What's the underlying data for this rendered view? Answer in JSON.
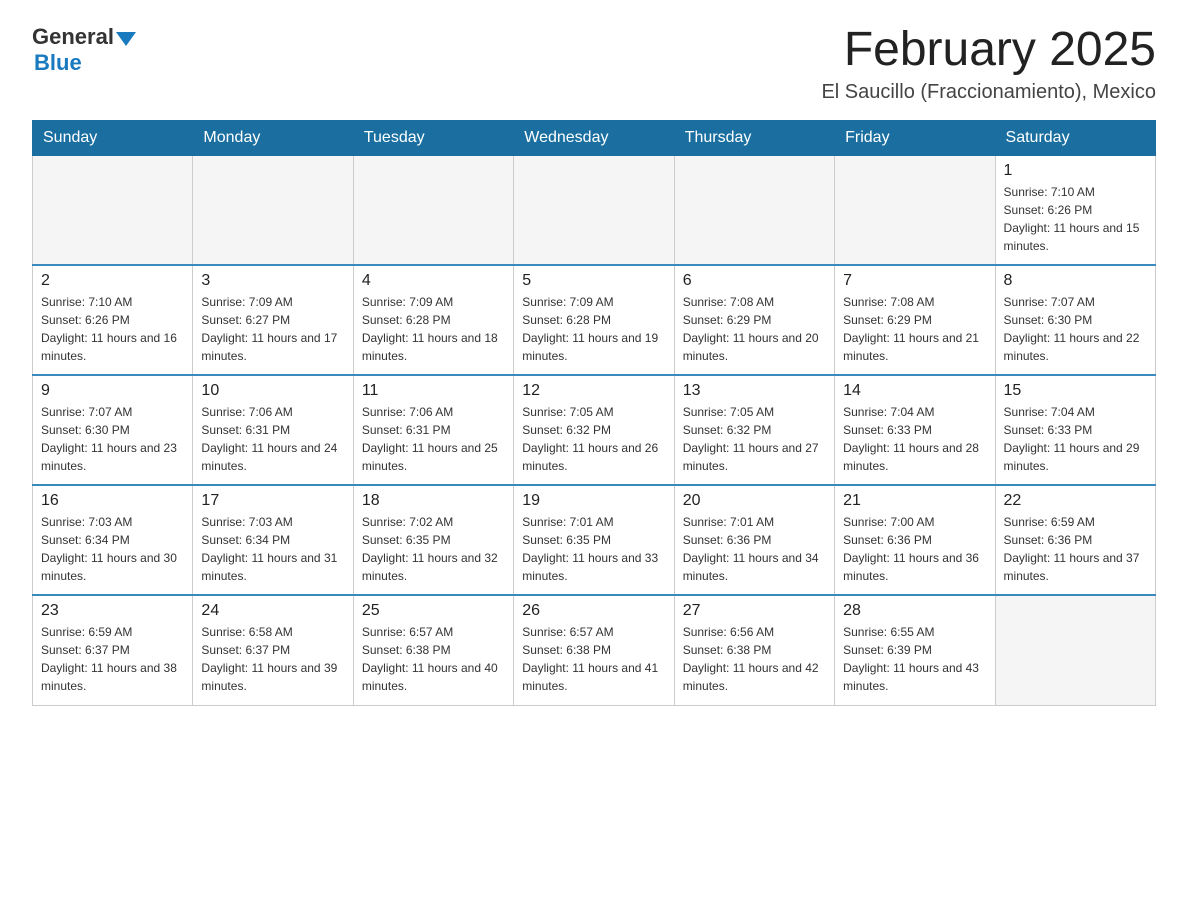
{
  "logo": {
    "general": "General",
    "blue": "Blue"
  },
  "header": {
    "month_title": "February 2025",
    "location": "El Saucillo (Fraccionamiento), Mexico"
  },
  "days_of_week": [
    "Sunday",
    "Monday",
    "Tuesday",
    "Wednesday",
    "Thursday",
    "Friday",
    "Saturday"
  ],
  "weeks": [
    [
      {
        "day": "",
        "sunrise": "",
        "sunset": "",
        "daylight": "",
        "empty": true
      },
      {
        "day": "",
        "sunrise": "",
        "sunset": "",
        "daylight": "",
        "empty": true
      },
      {
        "day": "",
        "sunrise": "",
        "sunset": "",
        "daylight": "",
        "empty": true
      },
      {
        "day": "",
        "sunrise": "",
        "sunset": "",
        "daylight": "",
        "empty": true
      },
      {
        "day": "",
        "sunrise": "",
        "sunset": "",
        "daylight": "",
        "empty": true
      },
      {
        "day": "",
        "sunrise": "",
        "sunset": "",
        "daylight": "",
        "empty": true
      },
      {
        "day": "1",
        "sunrise": "Sunrise: 7:10 AM",
        "sunset": "Sunset: 6:26 PM",
        "daylight": "Daylight: 11 hours and 15 minutes.",
        "empty": false
      }
    ],
    [
      {
        "day": "2",
        "sunrise": "Sunrise: 7:10 AM",
        "sunset": "Sunset: 6:26 PM",
        "daylight": "Daylight: 11 hours and 16 minutes.",
        "empty": false
      },
      {
        "day": "3",
        "sunrise": "Sunrise: 7:09 AM",
        "sunset": "Sunset: 6:27 PM",
        "daylight": "Daylight: 11 hours and 17 minutes.",
        "empty": false
      },
      {
        "day": "4",
        "sunrise": "Sunrise: 7:09 AM",
        "sunset": "Sunset: 6:28 PM",
        "daylight": "Daylight: 11 hours and 18 minutes.",
        "empty": false
      },
      {
        "day": "5",
        "sunrise": "Sunrise: 7:09 AM",
        "sunset": "Sunset: 6:28 PM",
        "daylight": "Daylight: 11 hours and 19 minutes.",
        "empty": false
      },
      {
        "day": "6",
        "sunrise": "Sunrise: 7:08 AM",
        "sunset": "Sunset: 6:29 PM",
        "daylight": "Daylight: 11 hours and 20 minutes.",
        "empty": false
      },
      {
        "day": "7",
        "sunrise": "Sunrise: 7:08 AM",
        "sunset": "Sunset: 6:29 PM",
        "daylight": "Daylight: 11 hours and 21 minutes.",
        "empty": false
      },
      {
        "day": "8",
        "sunrise": "Sunrise: 7:07 AM",
        "sunset": "Sunset: 6:30 PM",
        "daylight": "Daylight: 11 hours and 22 minutes.",
        "empty": false
      }
    ],
    [
      {
        "day": "9",
        "sunrise": "Sunrise: 7:07 AM",
        "sunset": "Sunset: 6:30 PM",
        "daylight": "Daylight: 11 hours and 23 minutes.",
        "empty": false
      },
      {
        "day": "10",
        "sunrise": "Sunrise: 7:06 AM",
        "sunset": "Sunset: 6:31 PM",
        "daylight": "Daylight: 11 hours and 24 minutes.",
        "empty": false
      },
      {
        "day": "11",
        "sunrise": "Sunrise: 7:06 AM",
        "sunset": "Sunset: 6:31 PM",
        "daylight": "Daylight: 11 hours and 25 minutes.",
        "empty": false
      },
      {
        "day": "12",
        "sunrise": "Sunrise: 7:05 AM",
        "sunset": "Sunset: 6:32 PM",
        "daylight": "Daylight: 11 hours and 26 minutes.",
        "empty": false
      },
      {
        "day": "13",
        "sunrise": "Sunrise: 7:05 AM",
        "sunset": "Sunset: 6:32 PM",
        "daylight": "Daylight: 11 hours and 27 minutes.",
        "empty": false
      },
      {
        "day": "14",
        "sunrise": "Sunrise: 7:04 AM",
        "sunset": "Sunset: 6:33 PM",
        "daylight": "Daylight: 11 hours and 28 minutes.",
        "empty": false
      },
      {
        "day": "15",
        "sunrise": "Sunrise: 7:04 AM",
        "sunset": "Sunset: 6:33 PM",
        "daylight": "Daylight: 11 hours and 29 minutes.",
        "empty": false
      }
    ],
    [
      {
        "day": "16",
        "sunrise": "Sunrise: 7:03 AM",
        "sunset": "Sunset: 6:34 PM",
        "daylight": "Daylight: 11 hours and 30 minutes.",
        "empty": false
      },
      {
        "day": "17",
        "sunrise": "Sunrise: 7:03 AM",
        "sunset": "Sunset: 6:34 PM",
        "daylight": "Daylight: 11 hours and 31 minutes.",
        "empty": false
      },
      {
        "day": "18",
        "sunrise": "Sunrise: 7:02 AM",
        "sunset": "Sunset: 6:35 PM",
        "daylight": "Daylight: 11 hours and 32 minutes.",
        "empty": false
      },
      {
        "day": "19",
        "sunrise": "Sunrise: 7:01 AM",
        "sunset": "Sunset: 6:35 PM",
        "daylight": "Daylight: 11 hours and 33 minutes.",
        "empty": false
      },
      {
        "day": "20",
        "sunrise": "Sunrise: 7:01 AM",
        "sunset": "Sunset: 6:36 PM",
        "daylight": "Daylight: 11 hours and 34 minutes.",
        "empty": false
      },
      {
        "day": "21",
        "sunrise": "Sunrise: 7:00 AM",
        "sunset": "Sunset: 6:36 PM",
        "daylight": "Daylight: 11 hours and 36 minutes.",
        "empty": false
      },
      {
        "day": "22",
        "sunrise": "Sunrise: 6:59 AM",
        "sunset": "Sunset: 6:36 PM",
        "daylight": "Daylight: 11 hours and 37 minutes.",
        "empty": false
      }
    ],
    [
      {
        "day": "23",
        "sunrise": "Sunrise: 6:59 AM",
        "sunset": "Sunset: 6:37 PM",
        "daylight": "Daylight: 11 hours and 38 minutes.",
        "empty": false
      },
      {
        "day": "24",
        "sunrise": "Sunrise: 6:58 AM",
        "sunset": "Sunset: 6:37 PM",
        "daylight": "Daylight: 11 hours and 39 minutes.",
        "empty": false
      },
      {
        "day": "25",
        "sunrise": "Sunrise: 6:57 AM",
        "sunset": "Sunset: 6:38 PM",
        "daylight": "Daylight: 11 hours and 40 minutes.",
        "empty": false
      },
      {
        "day": "26",
        "sunrise": "Sunrise: 6:57 AM",
        "sunset": "Sunset: 6:38 PM",
        "daylight": "Daylight: 11 hours and 41 minutes.",
        "empty": false
      },
      {
        "day": "27",
        "sunrise": "Sunrise: 6:56 AM",
        "sunset": "Sunset: 6:38 PM",
        "daylight": "Daylight: 11 hours and 42 minutes.",
        "empty": false
      },
      {
        "day": "28",
        "sunrise": "Sunrise: 6:55 AM",
        "sunset": "Sunset: 6:39 PM",
        "daylight": "Daylight: 11 hours and 43 minutes.",
        "empty": false
      },
      {
        "day": "",
        "sunrise": "",
        "sunset": "",
        "daylight": "",
        "empty": true
      }
    ]
  ]
}
